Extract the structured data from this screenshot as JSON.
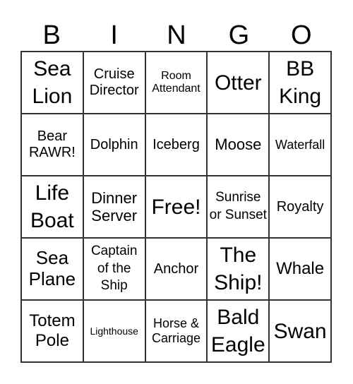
{
  "header": [
    "B",
    "I",
    "N",
    "G",
    "O"
  ],
  "cells": [
    "Sea Lion",
    "Cruise Director",
    "Room Attendant",
    "Otter",
    "BB King",
    "Bear RAWR!",
    "Dolphin",
    "Iceberg",
    "Moose",
    "Waterfall",
    "Life Boat",
    "Dinner Server",
    "Free!",
    "Sunrise or Sunset",
    "Royalty",
    "Sea Plane",
    "Captain of the Ship",
    "Anchor",
    "The Ship!",
    "Whale",
    "Totem Pole",
    "Lighthouse",
    "Horse & Carriage",
    "Bald Eagle",
    "Swan"
  ]
}
